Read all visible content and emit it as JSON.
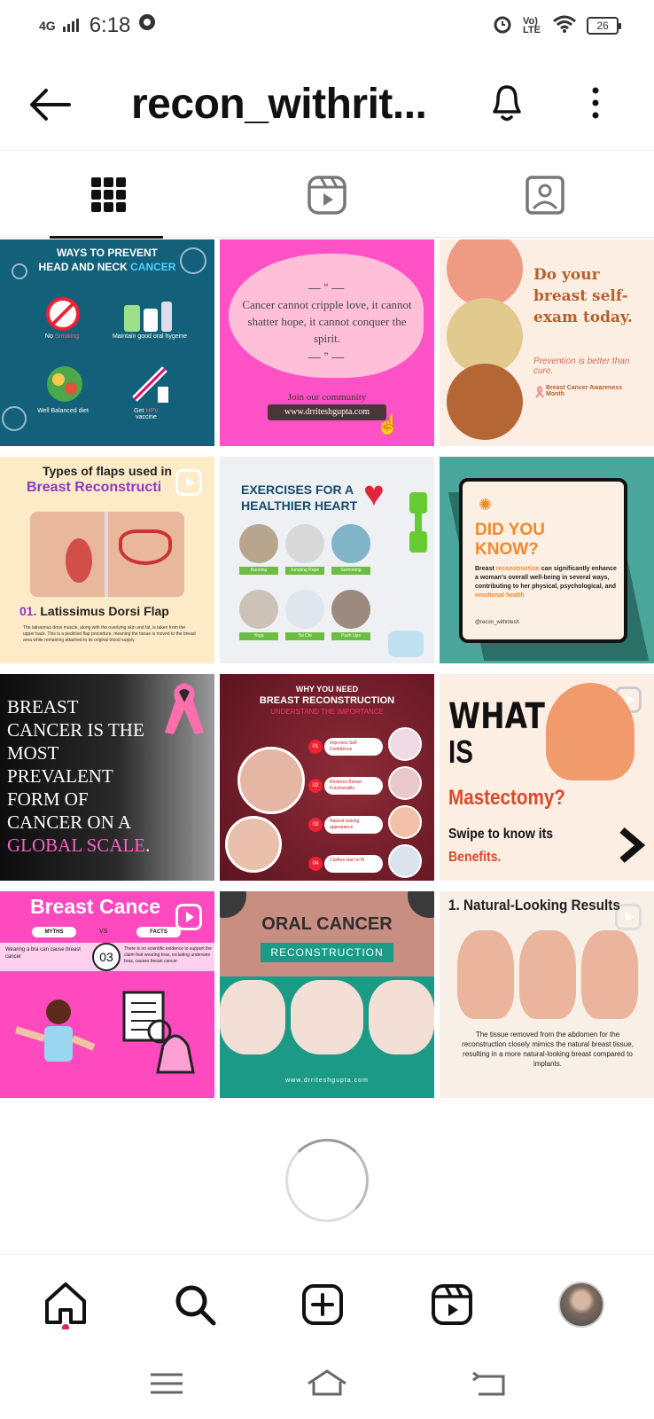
{
  "status": {
    "network": "4G",
    "time": "6:18",
    "volte": "Vo) LTE",
    "battery": "26"
  },
  "header": {
    "title": "recon_withrit...",
    "back_icon": "arrow-left-icon",
    "bell_icon": "bell-icon",
    "more_icon": "more-vertical-icon"
  },
  "tabs": [
    {
      "name": "grid",
      "icon": "grid-icon"
    },
    {
      "name": "reels",
      "icon": "reels-icon"
    },
    {
      "name": "tagged",
      "icon": "tagged-person-icon"
    }
  ],
  "posts": {
    "p1": {
      "line1": "WAYS TO PREVENT",
      "line2": "HEAD AND NECK",
      "line2b": "CANCER",
      "i1a": "No ",
      "i1b": "Smoking",
      "i2": "Maintain good oral hygeine",
      "i3": "Well Balanced diet",
      "i4a": "Get ",
      "i4b": "HPV",
      "i4c": "vaccine"
    },
    "p2": {
      "quote": "Cancer cannot cripple love, it cannot shatter hope, it cannot conquer the spirit.",
      "join": "Join our community",
      "url": "www.drriteshgupta.com"
    },
    "p3": {
      "heading": "Do your breast self-exam today.",
      "sub": "Prevention is better than cure.",
      "badge": "Breast Cancer Awareness Month"
    },
    "p4": {
      "line1": "Types of flaps used in",
      "line2": "Breast Reconstructi",
      "num": "01.",
      "flap": "Latissimus Dorsi Flap",
      "body": "The latissimus dorsi muscle, along with the overlying skin and fat, is taken from the upper back. This is a pedicled flap procedure, meaning the tissue is moved to the breast area while remaining attached to its original blood supply."
    },
    "p5": {
      "title": "EXERCISES FOR A HEALTHIER HEART",
      "labels": [
        "Running",
        "Jumping Rope",
        "Swimming",
        "Yoga",
        "Tai Chi",
        "Push Ups"
      ]
    },
    "p6": {
      "title1": "DID YOU",
      "title2": "KNOW?",
      "bodyA": "Breast ",
      "bodyB": "reconstruction",
      "bodyC": " can significantly enhance a woman's overall well-being in several ways, contributing to her physical, psychological, and ",
      "bodyD": "emotional health",
      "handle": "@recon_withritesh"
    },
    "p7": {
      "text1": "BREAST CANCER IS THE MOST PREVALENT FORM OF CANCER ON A ",
      "text2": "GLOBAL SCALE",
      "text3": "."
    },
    "p8": {
      "title1": "WHY YOU NEED",
      "title2": "BREAST RECONSTRUCTION",
      "sub": "UNDERSTAND THE IMPORTANCE",
      "items": [
        "Improves Self Confidence",
        "Restores Breast Functionality",
        "Natural looking appearance",
        "Clothes start to fit"
      ],
      "nums": [
        "01",
        "02",
        "03",
        "04"
      ]
    },
    "p9": {
      "w1": "WHAT",
      "w2": "IS",
      "w3": "Mastectomy?",
      "w4": "Swipe to know its",
      "w5": "Benefits."
    },
    "p10": {
      "title": "Breast Cance",
      "myths": "MYTHS",
      "vs": "VS",
      "facts": "FACTS",
      "myth": "Wearing a bra can cause breast cancer",
      "num": "03",
      "fact": "There is no scientific evidence to support the claim that wearing bras, including underwire bras, causes breast cancer"
    },
    "p11": {
      "title": "ORAL CANCER",
      "sub": "RECONSTRUCTION",
      "url": "www.drriteshgupta.com"
    },
    "p12": {
      "title": "1. Natural-Looking Results",
      "body": "The tissue removed from the abdomen for the reconstruction closely mimics the natural breast tissue, resulting in a more natural-looking breast compared to implants."
    }
  },
  "bottom_nav": [
    {
      "name": "home",
      "icon": "home-icon"
    },
    {
      "name": "search",
      "icon": "search-icon"
    },
    {
      "name": "create",
      "icon": "plus-square-icon"
    },
    {
      "name": "reels",
      "icon": "reels-icon"
    },
    {
      "name": "profile",
      "icon": "avatar"
    }
  ],
  "colors": {
    "notif_dot": "#e0245e",
    "pink": "#ff4fc4",
    "teal": "#0f6a7a",
    "maroon": "#7a1f2b"
  }
}
